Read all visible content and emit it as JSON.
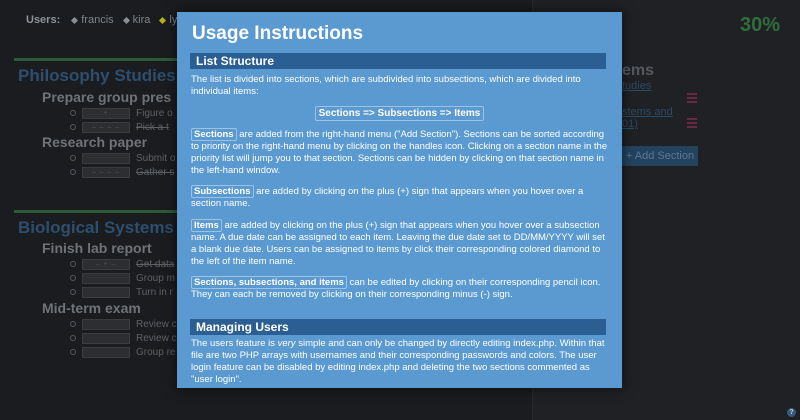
{
  "users_bar": {
    "label": "Users:",
    "users": [
      {
        "name": "francis",
        "color": "#8a8f96"
      },
      {
        "name": "kira",
        "color": "#8a8f96"
      },
      {
        "name": "lyo",
        "color": "#b8b21c"
      }
    ]
  },
  "progress": {
    "text": "30%",
    "value": 30
  },
  "sections": [
    {
      "title": "Philosophy Studies",
      "subsections": [
        {
          "title": "Prepare group pres",
          "items": [
            {
              "date": "+",
              "text": "Figure o",
              "done": false,
              "marker_color": "#8b2a3b"
            },
            {
              "date": "– – – –",
              "text": "Pick a t",
              "done": true
            }
          ]
        },
        {
          "title": "Research paper",
          "items": [
            {
              "date": "",
              "text": "Submit o",
              "done": false
            },
            {
              "date": "– – – –",
              "text": "Gather s",
              "done": true
            }
          ]
        }
      ]
    },
    {
      "title": "Biological Systems",
      "subsections": [
        {
          "title": "Finish lab report",
          "items": [
            {
              "date": "– + –",
              "text": "Get data",
              "done": true
            },
            {
              "date": "",
              "text": "Group m",
              "done": false
            },
            {
              "date": "",
              "text": "Turn in r",
              "done": false
            }
          ]
        },
        {
          "title": "Mid-term exam",
          "items": [
            {
              "date": "",
              "text": "Review c",
              "done": false
            },
            {
              "date": "",
              "text": "Review c",
              "done": false
            },
            {
              "date": "",
              "text": "Group re",
              "done": false
            }
          ]
        }
      ]
    }
  ],
  "right_panel": {
    "heading": "ems",
    "links": [
      "tudies",
      "stems and",
      "01)"
    ],
    "add_section_label": "+ Add Section"
  },
  "help": {
    "icon": "?"
  },
  "modal": {
    "title": "Usage Instructions",
    "list_structure": {
      "heading": "List Structure",
      "intro": "The list is divided into sections, which are subdivided into subsections, which are divided into individual items:",
      "formula": "Sections => Subsections => Items",
      "sections_kw": "Sections",
      "sections_text": " are added from the right-hand menu (\"Add Section\"). Sections can be sorted according to priority on the right-hand menu by clicking on the handles icon. Clicking on a section name in the priority list will jump you to that section. Sections can be hidden by clicking on that section name in the left-hand window.",
      "subsections_kw": "Subsections",
      "subsections_text": " are added by clicking on the plus (+) sign that appears when you hover over a section name.",
      "items_kw": "Items",
      "items_text": " are added by clicking on the plus (+) sign that appears when you hover over a subsection name. A due date can be assigned to each item. Leaving the due date set to DD/MM/YYYY will set a blank due date. Users can be assigned to items by click their corresponding colored diamond to the left of the item name.",
      "edit_kw": "Sections, subsections, and items",
      "edit_text": " can be edited by clicking on their corresponding pencil icon. They can each be removed by clicking on their corresponding minus (-) sign."
    },
    "managing_users": {
      "heading": "Managing Users",
      "text_a": "The users feature is ",
      "text_em": "very",
      "text_b": " simple and can only be changed by directly editing index.php. Within that file are two PHP arrays with usernames and their corresponding passwords and colors. The user login feature can be disabled by editing index.php and deleting the two sections commented as \"user login\"."
    }
  }
}
